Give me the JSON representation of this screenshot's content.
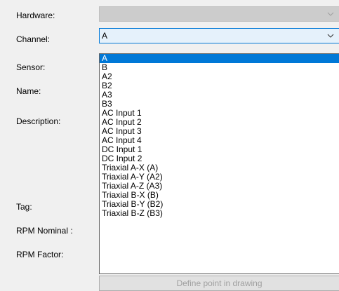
{
  "form": {
    "labels": {
      "hardware": "Hardware:",
      "channel": "Channel:",
      "sensor": "Sensor:",
      "name": "Name:",
      "description": "Description:",
      "tag": "Tag:",
      "rpm_nominal": "RPM Nominal :",
      "rpm_factor": "RPM Factor:"
    },
    "hardware_value": "",
    "channel_value": "A",
    "bottom_button_label": "Define point in drawing"
  },
  "dropdown": {
    "selected_index": 0,
    "items": [
      "A",
      "B",
      "A2",
      "B2",
      "A3",
      "B3",
      "AC Input 1",
      "AC Input 2",
      "AC Input 3",
      "AC Input 4",
      "DC Input 1",
      "DC Input 2",
      "Triaxial A-X (A)",
      "Triaxial A-Y (A2)",
      "Triaxial A-Z (A3)",
      "Triaxial B-X (B)",
      "Triaxial B-Y (B2)",
      "Triaxial B-Z (B3)"
    ]
  },
  "icons": {
    "hardware_arrow": "chevron-down-icon",
    "channel_arrow": "chevron-down-icon"
  },
  "colors": {
    "selection": "#0078d7",
    "focus_fill": "#e5f1fb",
    "disabled_fill": "#cccccc"
  }
}
